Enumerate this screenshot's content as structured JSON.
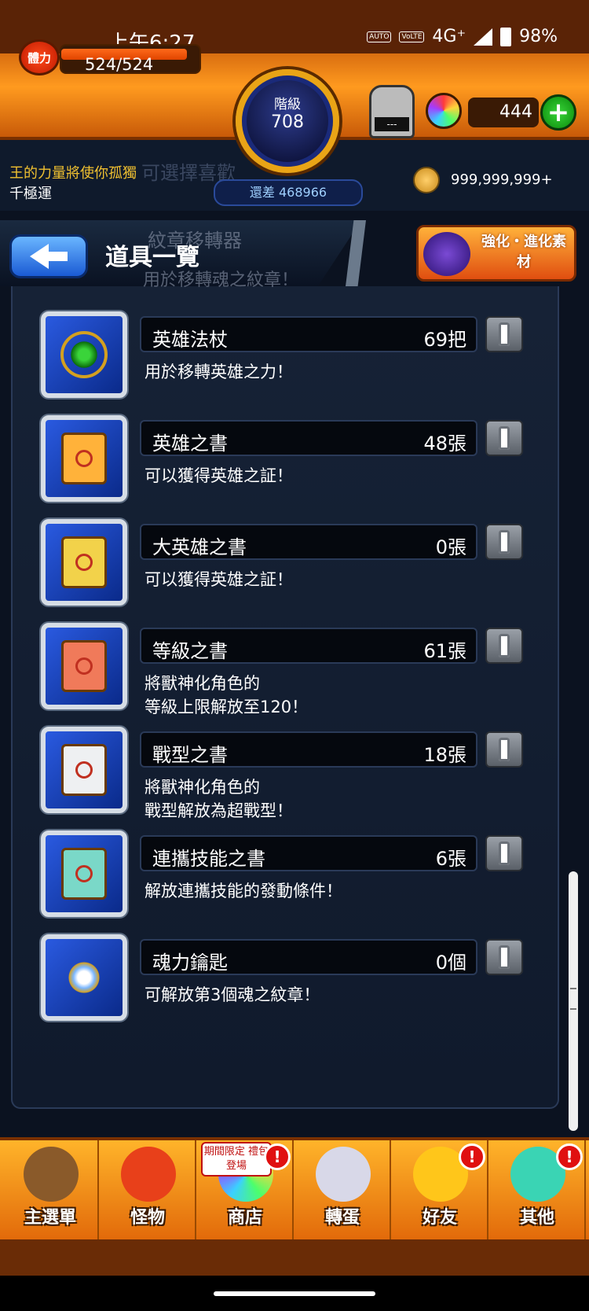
{
  "status_bar": {
    "time": "上午6:27",
    "badges": [
      "AUTO",
      "VoLTE"
    ],
    "network": "4G⁺",
    "battery": "98%"
  },
  "header": {
    "stamina_label": "體力",
    "stamina_text": "524/524",
    "stamina_fraction": 1.0,
    "rank_label": "階級",
    "rank_value": "708",
    "rank_next": "還差 468966",
    "machine_screen": "---",
    "orb_count": "444",
    "add_symbol": "+",
    "coin_value": "999,999,999+",
    "marquee_title": "王的力量將使你孤獨",
    "marquee_sub": "千極運",
    "marquee_ghost": "可選擇喜歡"
  },
  "page": {
    "title": "道具一覽",
    "ghost_item_title": "紋章移轉器",
    "ghost_item_desc": "用於移轉魂之紋章！",
    "materials_label": "強化・進化素材"
  },
  "items": [
    {
      "name": "英雄法杖",
      "count": "69把",
      "desc": [
        "用於移轉英雄之力！"
      ],
      "art": "staff",
      "color": "#d4a020"
    },
    {
      "name": "英雄之書",
      "count": "48張",
      "desc": [
        "可以獲得英雄之証！"
      ],
      "art": "scroll",
      "color": "#ffb23a"
    },
    {
      "name": "大英雄之書",
      "count": "0張",
      "desc": [
        "可以獲得英雄之証！"
      ],
      "art": "scroll",
      "color": "#f2d24a"
    },
    {
      "name": "等級之書",
      "count": "61張",
      "desc": [
        "將獸神化角色的",
        "等級上限解放至120！"
      ],
      "art": "scroll",
      "color": "#f07a5a"
    },
    {
      "name": "戰型之書",
      "count": "18張",
      "desc": [
        "將獸神化角色的",
        "戰型解放為超戰型！"
      ],
      "art": "scroll",
      "color": "#eef0f2"
    },
    {
      "name": "連攜技能之書",
      "count": "6張",
      "desc": [
        "解放連攜技能的發動條件！"
      ],
      "art": "scroll",
      "color": "#7ad8c8"
    },
    {
      "name": "魂力鑰匙",
      "count": "0個",
      "desc": [
        "可解放第3個魂之紋章！"
      ],
      "art": "key",
      "color": "#7ab6ff"
    }
  ],
  "nav": [
    {
      "label": "主選單",
      "icon": "castle-icon",
      "alert": false
    },
    {
      "label": "怪物",
      "icon": "monster-icon",
      "alert": false
    },
    {
      "label": "商店",
      "icon": "shop-icon",
      "alert": true,
      "badge": "期間限定 禮包登場"
    },
    {
      "label": "轉蛋",
      "icon": "gacha-icon",
      "alert": false
    },
    {
      "label": "好友",
      "icon": "friends-icon",
      "alert": true
    },
    {
      "label": "其他",
      "icon": "other-icon",
      "alert": true
    }
  ],
  "alert_symbol": "!"
}
